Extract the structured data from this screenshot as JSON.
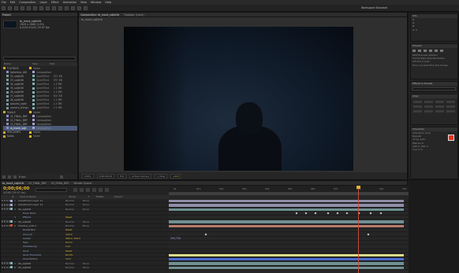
{
  "menu": [
    "File",
    "Edit",
    "Composition",
    "Layer",
    "Effect",
    "Animation",
    "View",
    "Window",
    "Help"
  ],
  "workspace": {
    "label": "Workspace",
    "value": "Standard"
  },
  "project": {
    "tab": "Project",
    "item_name": "to_mock_sajtchik",
    "item_info": [
      "1920 x 1080 (1.00)",
      "Δ 0;00;10;00, 29.97 fps"
    ],
    "columns": [
      "Name",
      "Type",
      "Size"
    ],
    "rows": [
      {
        "name": "FOOTAGE",
        "type": "Folder",
        "size": "",
        "kind": "folder",
        "color": "#e0b431"
      },
      {
        "name": "Spikeless_AW",
        "type": "Composition",
        "size": "",
        "kind": "comp",
        "color": "#a3a3d8"
      },
      {
        "name": "02_sajtk06",
        "type": "QuickTime",
        "size": "937 KB",
        "kind": "foot",
        "color": "#7fb0b3"
      },
      {
        "name": "03_sajtk06",
        "type": "QuickTime",
        "size": "937 KB",
        "kind": "foot",
        "color": "#7fb0b3"
      },
      {
        "name": "04_sajtk06",
        "type": "QuickTime",
        "size": "1.4 MB",
        "kind": "foot",
        "color": "#7fb0b3"
      },
      {
        "name": "05_sajtk06",
        "type": "QuickTime",
        "size": "1.1 MB",
        "kind": "foot",
        "color": "#7fb0b3"
      },
      {
        "name": "06_sajtk06",
        "type": "QuickTime",
        "size": "1.1 MB",
        "kind": "foot",
        "color": "#7fb0b3"
      },
      {
        "name": "07_sajtk06",
        "type": "QuickTime",
        "size": "801 KB",
        "kind": "foot",
        "color": "#7fb0b3"
      },
      {
        "name": "08_sajtk06",
        "type": "QuickTime",
        "size": "1.1 MB",
        "kind": "foot",
        "color": "#7fb0b3"
      },
      {
        "name": "warped_sajte",
        "type": "QuickTime",
        "size": "1.2 MB",
        "kind": "foot",
        "color": "#7fb0b3"
      },
      {
        "name": "camera_things",
        "type": "QuickTime",
        "size": "1.1 MB",
        "kind": "foot",
        "color": "#7fb0b3"
      },
      {
        "name": "FINALE",
        "type": "Folder",
        "size": "",
        "kind": "folder",
        "color": "#e0b431"
      },
      {
        "name": "01_FINAL_BRF",
        "type": "Composition",
        "size": "",
        "kind": "comp",
        "color": "#a3a3d8"
      },
      {
        "name": "02_FINAL_BRF",
        "type": "Composition",
        "size": "",
        "kind": "comp",
        "color": "#a3a3d8"
      },
      {
        "name": "03_FINAL_BRF",
        "type": "Composition",
        "size": "",
        "kind": "comp",
        "color": "#a3a3d8"
      },
      {
        "name": "to_mock_sajt",
        "type": "Composition",
        "size": "",
        "kind": "comp",
        "color": "#a3a3d8",
        "selected": true
      },
      {
        "name": "PRECOMPS",
        "type": "Folder",
        "size": "",
        "kind": "folder",
        "color": "#e0b431"
      },
      {
        "name": "Solids",
        "type": "Folder",
        "size": "",
        "kind": "folder",
        "color": "#e0b431"
      }
    ],
    "footer_bpc": "8 bpc"
  },
  "comp": {
    "tabs": [
      "Composition: to_mock_sajtchik",
      "Footage: (none)"
    ],
    "breadcrumb": "to_mock_sajtchik",
    "footer": [
      "100%",
      "0;00;06;00",
      "Full",
      "Active Camera",
      "1 View",
      "+0.0"
    ]
  },
  "right_panels": {
    "info": {
      "title": "Info",
      "rows": [
        "R:",
        "G:",
        "B:",
        "A: 0"
      ]
    },
    "preview": {
      "title": "Preview",
      "rows": [
        "RAM Preview Options",
        "Frame Rate  Skip  Resolution",
        "(29.97)  0  Auto",
        "From Current Time  Full Screen"
      ]
    },
    "effects": {
      "title": "Effects & Presets"
    },
    "align": {
      "title": "Align"
    },
    "character": {
      "title": "Character",
      "rows": [
        "Liberation Sans",
        "Regular",
        "72 px  Auto",
        "Metrics  0",
        "100 %  100 %",
        "0 px  0 %"
      ]
    }
  },
  "timeline": {
    "tabs": [
      "to_mock_sajtchik",
      "01_FINAL_BRF",
      "02_FINAL_BRF",
      "Render Queue"
    ],
    "current_time": "0;00;06;00",
    "frame_info": "00180 (29.97 fps)",
    "columns": [
      "#",
      "Source Name",
      "Mode",
      "T",
      "TrkMat",
      "Parent"
    ],
    "ruler_ticks": [
      "0s",
      "01s",
      "02s",
      "03s",
      "04s",
      "05s",
      "06s",
      "07s",
      "08s",
      "09s",
      "10s"
    ],
    "layers": [
      {
        "num": "1",
        "name": "Adjustment Layer 11",
        "mode": "Normal",
        "parent": "None",
        "label": "#a3a3d8"
      },
      {
        "num": "2",
        "name": "Adjustment Layer 12",
        "mode": "Normal",
        "parent": "None",
        "label": "#a3a3d8"
      },
      {
        "num": "3",
        "name": "06_sajtk06",
        "mode": "Normal",
        "parent": "None",
        "label": "#7fb0b3"
      },
      {
        "num": "",
        "name": "Track Point",
        "mode": "",
        "parent": "",
        "prop": true
      },
      {
        "num": "4",
        "name": "Effects",
        "mode": "",
        "parent": "",
        "prop": true,
        "value": "Reset"
      },
      {
        "num": "5",
        "name": "06_sajtk06",
        "mode": "Normal",
        "parent": "None",
        "label": "#7fb0b3"
      },
      {
        "num": "6",
        "name": "Shadow_solid 2",
        "mode": "Normal",
        "parent": "None",
        "label": "#c84a3a"
      },
      {
        "num": "",
        "name": "Radial Blur",
        "mode": "",
        "parent": "",
        "prop": true,
        "value": "Reset"
      },
      {
        "num": "",
        "name": "Amount",
        "mode": "",
        "parent": "",
        "prop": true,
        "value": "100.0"
      },
      {
        "num": "",
        "name": "Center",
        "mode": "",
        "parent": "",
        "prop": true,
        "value": "960.0, 540.0"
      },
      {
        "num": "",
        "name": "Type",
        "mode": "",
        "parent": "",
        "prop": true,
        "value": "Zoom"
      },
      {
        "num": "",
        "name": "Antialiasing",
        "mode": "",
        "parent": "",
        "prop": true,
        "value": "Low"
      },
      {
        "num": "",
        "name": "Glow",
        "mode": "",
        "parent": "",
        "prop": true,
        "value": "Reset"
      },
      {
        "num": "",
        "name": "Glow Threshold",
        "mode": "",
        "parent": "",
        "prop": true,
        "value": "60.0%"
      },
      {
        "num": "",
        "name": "Glow Radius",
        "mode": "",
        "parent": "",
        "prop": true,
        "value": "10.0"
      },
      {
        "num": "7",
        "name": "06_sajtk06",
        "mode": "Normal",
        "parent": "None",
        "label": "#7fb0b3"
      },
      {
        "num": "8",
        "name": "05_sajtk06",
        "mode": "Normal",
        "parent": "None",
        "label": "#7fb0b3"
      }
    ],
    "bars": [
      {
        "start": 0,
        "end": 0.98,
        "color": "#8e8ea8"
      },
      {
        "start": 0,
        "end": 0.98,
        "color": "#8e8ea8"
      },
      {
        "start": 0,
        "end": 0.98,
        "color": "#6f9093"
      },
      {
        "start": 0,
        "end": 0,
        "color": "",
        "keys": [
          0.53,
          0.57,
          0.61,
          0.66,
          0.7,
          0.74,
          0.79,
          0.84,
          0.88
        ]
      },
      {
        "start": 0,
        "end": 0,
        "color": ""
      },
      {
        "start": 0,
        "end": 0.98,
        "color": "#6f9093"
      },
      {
        "start": 0,
        "end": 0.98,
        "color": "#b77b6d"
      },
      {
        "start": 0,
        "end": 0,
        "color": ""
      },
      {
        "start": 0,
        "end": 0,
        "color": "",
        "keys": [
          0.15,
          0.83
        ]
      },
      {
        "start": 0,
        "end": 0,
        "color": "",
        "label": "294,754"
      },
      {
        "start": 0,
        "end": 0,
        "color": ""
      },
      {
        "start": 0,
        "end": 0,
        "color": ""
      },
      {
        "start": 0,
        "end": 0,
        "color": ""
      },
      {
        "start": 0,
        "end": 0.98,
        "color": "#dcdc8c"
      },
      {
        "start": 0,
        "end": 0.98,
        "color": "#4a6bd0"
      },
      {
        "start": 0,
        "end": 0.98,
        "color": "#6f9093"
      },
      {
        "start": 0,
        "end": 0.98,
        "color": "#6f9093"
      }
    ],
    "playhead": 0.79
  },
  "colors": {
    "accent": "#e0b431",
    "selection": "#4b5a78",
    "fg_swatch": "#e8321e"
  }
}
